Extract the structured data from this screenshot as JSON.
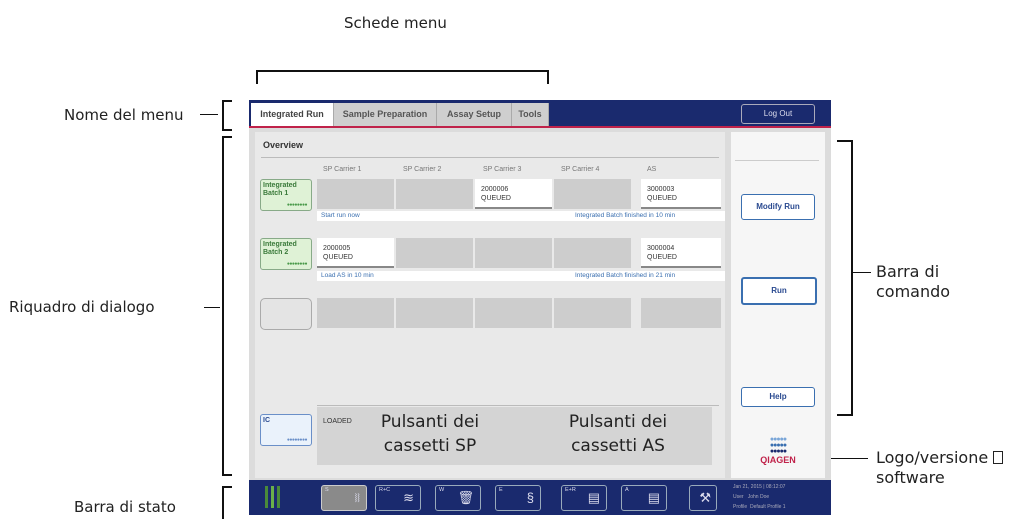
{
  "annotations": {
    "schede_menu": "Schede menu",
    "nome_menu": "Nome del menu",
    "riquadro": "Riquadro di dialogo",
    "barra_stato": "Barra di stato",
    "barra_comando_1": "Barra di",
    "barra_comando_2": "comando",
    "logo_1": "Logo/versione",
    "logo_2": "software",
    "pulsanti_sp_1": "Pulsanti dei",
    "pulsanti_sp_2": "cassetti SP",
    "pulsanti_as_1": "Pulsanti dei",
    "pulsanti_as_2": "cassetti AS"
  },
  "tabs": [
    "Integrated Run",
    "Sample Preparation",
    "Assay Setup",
    "Tools"
  ],
  "logout": "Log Out",
  "overview": "Overview",
  "columns": [
    "SP Carrier 1",
    "SP Carrier 2",
    "SP Carrier 3",
    "SP Carrier 4",
    "AS"
  ],
  "batch1": {
    "label1": "Integrated",
    "label2": "Batch 1",
    "cell3_a": "2000006",
    "cell3_b": "QUEUED",
    "as_a": "3000003",
    "as_b": "QUEUED",
    "info_left": "Start run now",
    "info_right": "Integrated Batch finished in 10 min"
  },
  "batch2": {
    "label1": "Integrated",
    "label2": "Batch 2",
    "cell1_a": "2000005",
    "cell1_b": "QUEUED",
    "as_a": "3000004",
    "as_b": "QUEUED",
    "info_left": "Load AS in 10 min",
    "info_right": "Integrated Batch finished in 21 min"
  },
  "ic": {
    "label": "IC",
    "status": "LOADED"
  },
  "side_buttons": {
    "modify": "Modify Run",
    "run": "Run",
    "help": "Help"
  },
  "logo": "QIAGEN",
  "drawers": [
    {
      "label": "S"
    },
    {
      "label": "R+C"
    },
    {
      "label": "W"
    },
    {
      "label": "E"
    },
    {
      "label": "E+R"
    },
    {
      "label": "A"
    }
  ],
  "status": {
    "date": "Jan 21, 2015 | 08:12:07",
    "user_label": "User",
    "user": "John Doe",
    "profile_label": "Profile",
    "profile": "Default Profile 1"
  },
  "icons": [
    "door-icon",
    "tube-rack-icon",
    "reagent-icon",
    "waste-bin-icon",
    "eluate-icon",
    "drawer-grid-icon",
    "tools-icon"
  ]
}
